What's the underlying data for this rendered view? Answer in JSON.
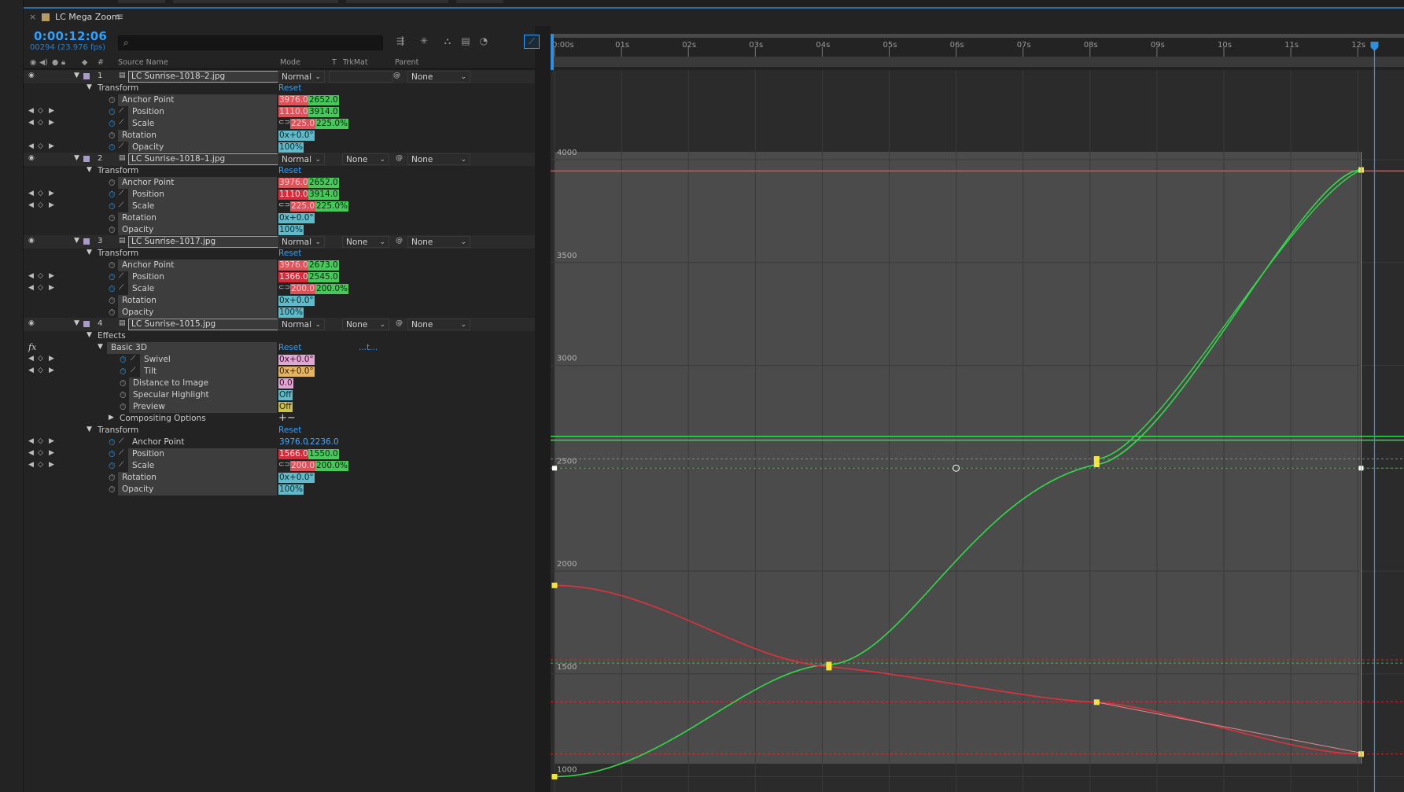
{
  "comp_tab": {
    "title": "LC Mega Zoom",
    "close": "×",
    "menu": "≡"
  },
  "header": {
    "timecode": "0:00:12:06",
    "fps": "00294 (23.976 fps)",
    "search_placeholder": ""
  },
  "columns": {
    "num": "#",
    "source_name": "Source Name",
    "mode": "Mode",
    "t": "T",
    "trkmat": "TrkMat",
    "parent": "Parent"
  },
  "layers": [
    {
      "num": "1",
      "name": "LC Sunrise–1018–2.jpg",
      "mode": "Normal",
      "trkmat": "",
      "parent": "None",
      "transform": "Transform",
      "reset": "Reset",
      "props": [
        {
          "name": "Anchor Point",
          "v1": "3976.0",
          "v2": "2652.0"
        },
        {
          "name": "Position",
          "v1": "1110.0",
          "v2": "3914.0"
        },
        {
          "name": "Scale",
          "v1": "225.0",
          "v2": "225.0%"
        },
        {
          "name": "Rotation",
          "v1": "0x+0.0°"
        },
        {
          "name": "Opacity",
          "v1": "100%"
        }
      ]
    },
    {
      "num": "2",
      "name": "LC Sunrise–1018–1.jpg",
      "mode": "Normal",
      "trkmat": "None",
      "parent": "None",
      "transform": "Transform",
      "reset": "Reset",
      "props": [
        {
          "name": "Anchor Point",
          "v1": "3976.0",
          "v2": "2652.0"
        },
        {
          "name": "Position",
          "v1": "1110.0",
          "v2": "3914.0"
        },
        {
          "name": "Scale",
          "v1": "225.0",
          "v2": "225.0%"
        },
        {
          "name": "Rotation",
          "v1": "0x+0.0°"
        },
        {
          "name": "Opacity",
          "v1": "100%"
        }
      ]
    },
    {
      "num": "3",
      "name": "LC Sunrise–1017.jpg",
      "mode": "Normal",
      "trkmat": "None",
      "parent": "None",
      "transform": "Transform",
      "reset": "Reset",
      "props": [
        {
          "name": "Anchor Point",
          "v1": "3976.0",
          "v2": "2673.0"
        },
        {
          "name": "Position",
          "v1": "1366.0",
          "v2": "2545.0"
        },
        {
          "name": "Scale",
          "v1": "200.0",
          "v2": "200.0%"
        },
        {
          "name": "Rotation",
          "v1": "0x+0.0°"
        },
        {
          "name": "Opacity",
          "v1": "100%"
        }
      ]
    },
    {
      "num": "4",
      "name": "LC Sunrise–1015.jpg",
      "mode": "Normal",
      "trkmat": "None",
      "parent": "None",
      "effects": "Effects",
      "effect": {
        "fx": "fx",
        "name": "Basic 3D",
        "reset": "Reset",
        "more": "...t...",
        "props": [
          {
            "name": "Swivel",
            "v1": "0x+0.0°"
          },
          {
            "name": "Tilt",
            "v1": "0x+0.0°"
          },
          {
            "name": "Distance to Image",
            "v1": "0.0"
          },
          {
            "name": "Specular Highlight",
            "v1": "Off"
          },
          {
            "name": "Preview",
            "v1": "Off"
          }
        ]
      },
      "compositing": "Compositing Options",
      "compositing_ctrl": "+−",
      "transform": "Transform",
      "reset": "Reset",
      "props": [
        {
          "name": "Anchor Point",
          "v1": "3976.0",
          "v2": "2236.0"
        },
        {
          "name": "Position",
          "v1": "1566.0",
          "v2": "1550.0"
        },
        {
          "name": "Scale",
          "v1": "200.0",
          "v2": "200.0%"
        },
        {
          "name": "Rotation",
          "v1": "0x+0.0°"
        },
        {
          "name": "Opacity",
          "v1": "100%"
        }
      ]
    }
  ],
  "graph": {
    "ruler_labels": [
      "0:00s",
      "01s",
      "02s",
      "03s",
      "04s",
      "05s",
      "06s",
      "07s",
      "08s",
      "09s",
      "10s",
      "11s",
      "12s"
    ],
    "y_labels": [
      "4000",
      "3500",
      "3000",
      "2500",
      "2000",
      "1500",
      "1000"
    ],
    "colors": {
      "x_curve": "#e0323c",
      "y_curve": "#33d94a",
      "keyframe": "#f2e63a",
      "playhead": "#2e8fe0"
    }
  }
}
